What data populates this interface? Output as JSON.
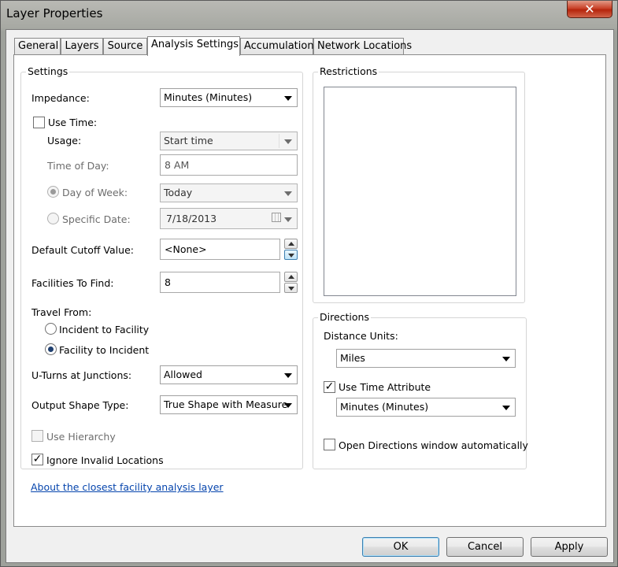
{
  "window": {
    "title": "Layer Properties",
    "close_label": "✕"
  },
  "tabs": [
    {
      "label": "General"
    },
    {
      "label": "Layers"
    },
    {
      "label": "Source"
    },
    {
      "label": "Analysis Settings",
      "active": true
    },
    {
      "label": "Accumulation"
    },
    {
      "label": "Network Locations"
    }
  ],
  "settings": {
    "group_title": "Settings",
    "impedance_label": "Impedance:",
    "impedance_value": "Minutes (Minutes)",
    "use_time_label": "Use Time:",
    "use_time_checked": false,
    "usage_label": "Usage:",
    "usage_value": "Start time",
    "time_of_day_label": "Time of Day:",
    "time_of_day_value": "8 AM",
    "day_of_week_label": "Day of Week:",
    "day_of_week_selected": true,
    "day_of_week_value": "Today",
    "specific_date_label": "Specific Date:",
    "specific_date_value": "7/18/2013",
    "default_cutoff_label": "Default Cutoff Value:",
    "default_cutoff_value": "<None>",
    "facilities_label": "Facilities To Find:",
    "facilities_value": "8",
    "travel_from_label": "Travel From:",
    "incident_to_facility_label": "Incident to Facility",
    "facility_to_incident_label": "Facility to Incident",
    "travel_from_selected": "Facility to Incident",
    "uturns_label": "U-Turns at Junctions:",
    "uturns_value": "Allowed",
    "output_shape_label": "Output Shape Type:",
    "output_shape_value": "True Shape with Measure",
    "use_hierarchy_label": "Use Hierarchy",
    "use_hierarchy_checked": false,
    "ignore_invalid_label": "Ignore Invalid Locations",
    "ignore_invalid_checked": true
  },
  "restrictions": {
    "group_title": "Restrictions"
  },
  "directions": {
    "group_title": "Directions",
    "distance_units_label": "Distance Units:",
    "distance_units_value": "Miles",
    "use_time_attr_label": "Use Time Attribute",
    "use_time_attr_checked": true,
    "time_attr_value": "Minutes (Minutes)",
    "open_window_label": "Open Directions window automatically",
    "open_window_checked": false
  },
  "about_link": "About the closest facility analysis layer",
  "buttons": {
    "ok": "OK",
    "cancel": "Cancel",
    "apply": "Apply"
  },
  "check_glyph": "✓"
}
